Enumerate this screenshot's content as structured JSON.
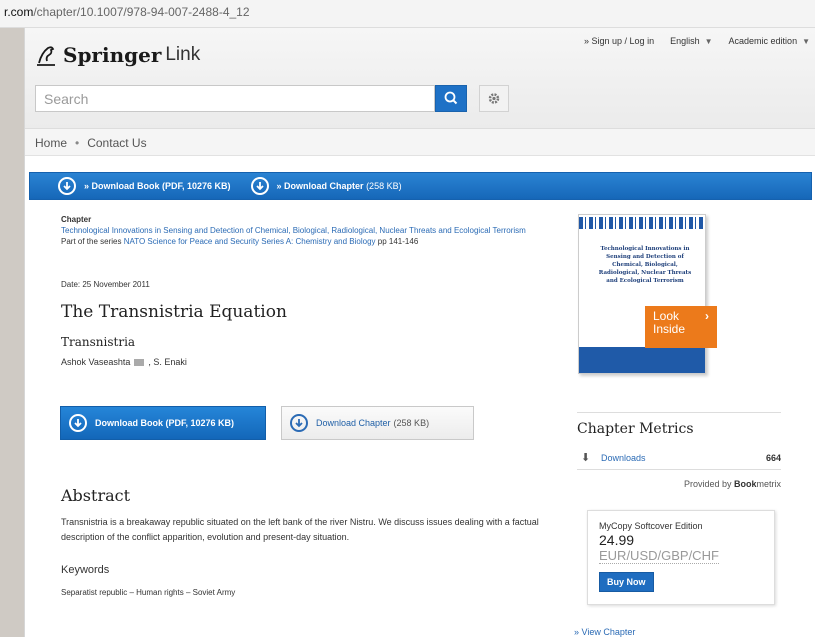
{
  "url": {
    "host": "r.com",
    "path": "/chapter/10.1007/978-94-007-2488-4_12"
  },
  "header": {
    "brand": "Springer",
    "brand_suffix": "Link",
    "signin": "» Sign up / Log in",
    "language": "English",
    "edition": "Academic edition",
    "search_placeholder": "Search"
  },
  "nav": {
    "home": "Home",
    "separator": "•",
    "contact": "Contact Us"
  },
  "download_bar": {
    "book_label": "» Download Book (PDF, 10276 KB)",
    "chapter_label": "» Download Chapter",
    "chapter_size": "(258 KB)"
  },
  "meta": {
    "chapter_label": "Chapter",
    "book_title": "Technological Innovations in Sensing and Detection of Chemical, Biological, Radiological, Nuclear Threats and Ecological Terrorism",
    "series_prefix": "Part of the series",
    "series_name": "NATO Science for Peace and Security Series A: Chemistry and Biology",
    "pages": "pp 141-146",
    "date": "Date: 25 November 2011"
  },
  "article": {
    "title": "The Transnistria Equation",
    "subtitle": "Transnistria",
    "author1": "Ashok Vaseashta",
    "author2": ", S. Enaki"
  },
  "buttons": {
    "download_book": "Download Book (PDF, 10276 KB)",
    "download_chapter": "Download Chapter",
    "chapter_size": "(258 KB)"
  },
  "abstract": {
    "heading": "Abstract",
    "text": "Transnistria is a breakaway republic situated on the left bank of the river Nistru. We discuss issues dealing with a factual description of the conflict apparition, evolution and present-day situation.",
    "keywords_heading": "Keywords",
    "keywords": "Separatist republic – Human rights – Soviet Army"
  },
  "cover": {
    "title": "Technological Innovations in Sensing and Detection of Chemical, Biological, Radiological, Nuclear Threats and Ecological Terrorism",
    "look_inside": "Look Inside"
  },
  "sidebar": {
    "metrics_heading": "Chapter Metrics",
    "downloads_label": "Downloads",
    "downloads_count": "664",
    "provided_by": "Provided by ",
    "provider_bold": "Book",
    "provider_rest": "metrix",
    "mycopy_title": "MyCopy Softcover Edition",
    "price": "24.99",
    "currencies": "EUR/USD/GBP/CHF",
    "buy_now": "Buy Now",
    "view_chapter": "» View Chapter"
  },
  "colors": {
    "accent_blue": "#1e71c6",
    "link_blue": "#2b6bb5",
    "look_inside_orange": "#ec7a1b"
  }
}
